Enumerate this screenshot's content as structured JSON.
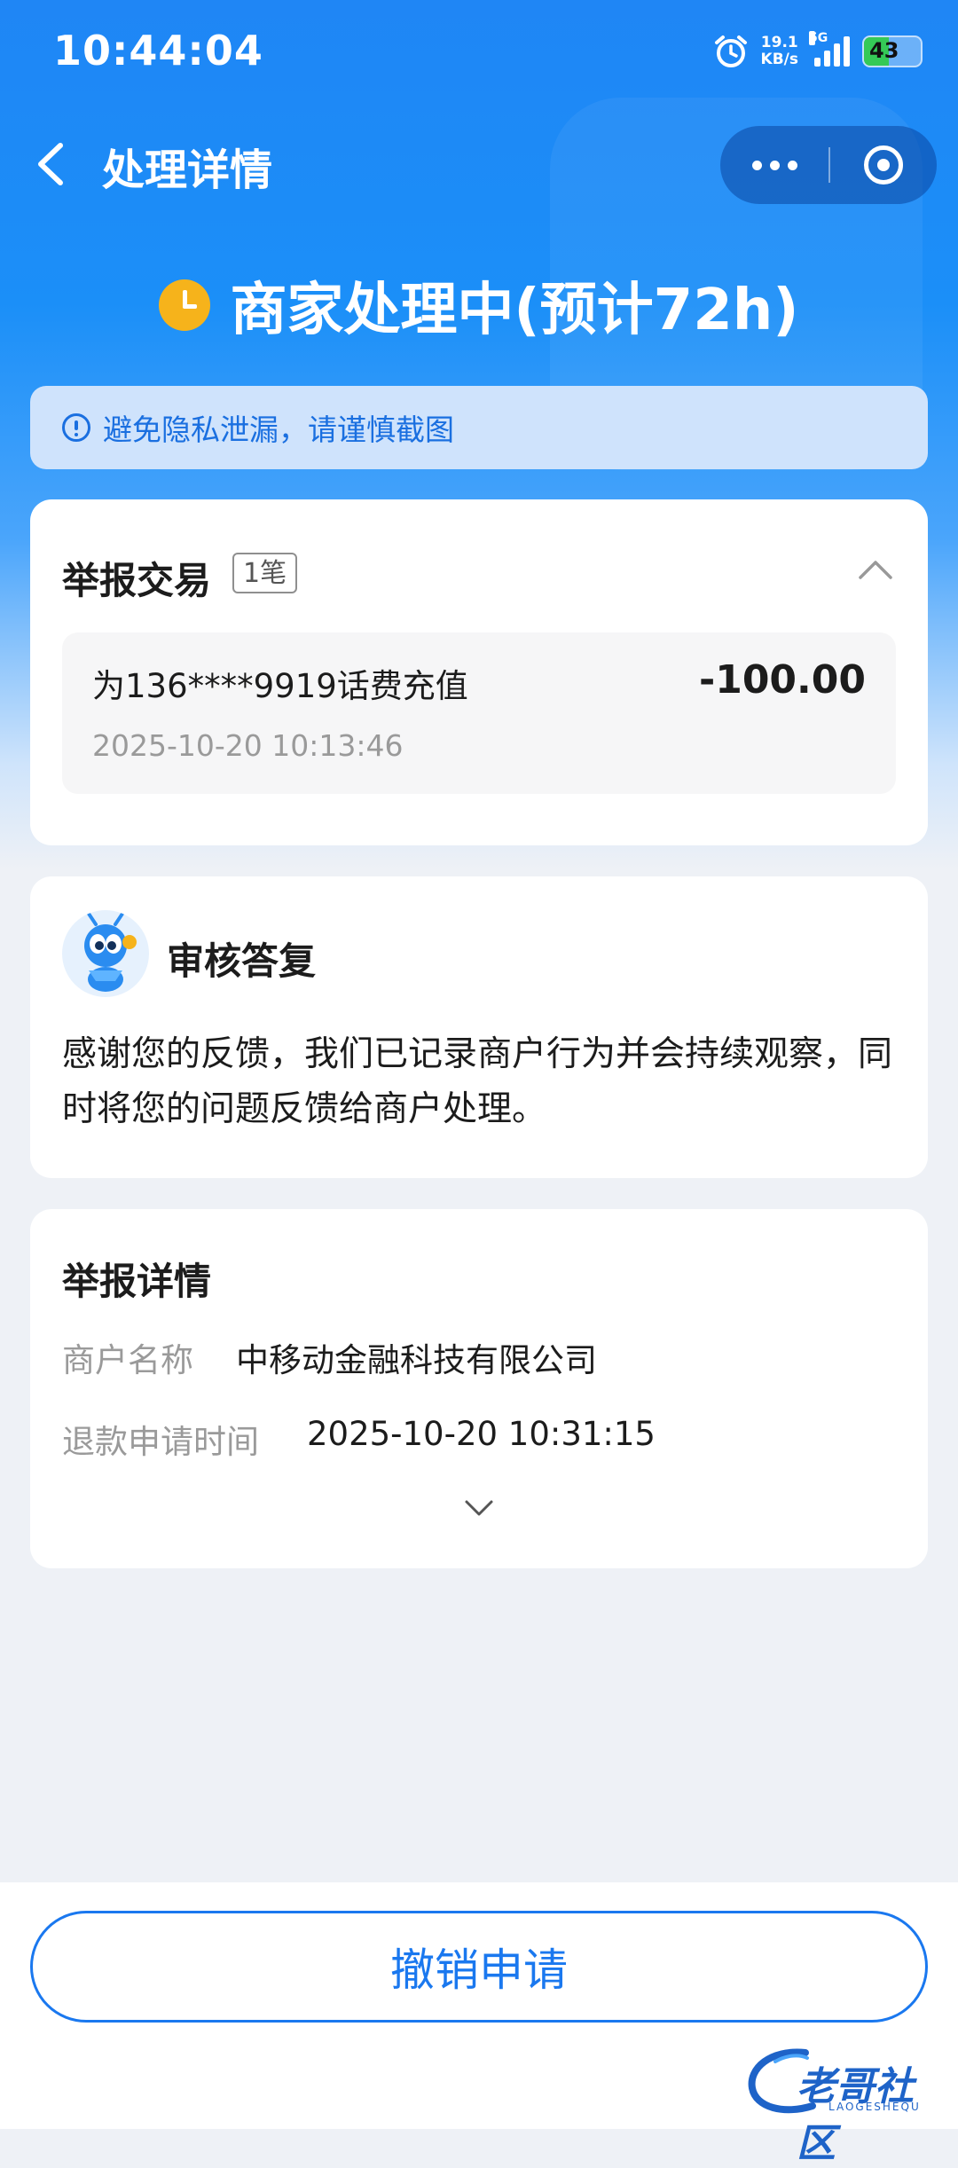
{
  "status_bar": {
    "time": "10:44:04",
    "net_speed_value": "19.1",
    "net_speed_unit": "KB/s",
    "network_type": "5G",
    "battery_level": "43",
    "battery_fraction": 0.43
  },
  "nav": {
    "title": "处理详情"
  },
  "status": {
    "text": "商家处理中(预计72h)",
    "icon": "clock-icon",
    "icon_color": "#f6b31b"
  },
  "notice": {
    "text": "避免隐私泄漏，请谨慎截图"
  },
  "report_transaction": {
    "title": "举报交易",
    "count_badge": "1笔",
    "item": {
      "name": "为136****9919话费充值",
      "amount": "-100.00",
      "time": "2025-10-20 10:13:46"
    }
  },
  "review_reply": {
    "title": "审核答复",
    "text": "感谢您的反馈，我们已记录商户行为并会持续观察，同时将您的问题反馈给商户处理。"
  },
  "report_details": {
    "title": "举报详情",
    "merchant_label": "商户名称",
    "merchant_value": "中移动金融科技有限公司",
    "refund_time_label": "退款申请时间",
    "refund_time_value": "2025-10-20 10:31:15"
  },
  "bottom": {
    "cancel_label": "撤销申请"
  },
  "watermark": {
    "text": "老哥社区",
    "subtext": "LAOGESHEQU"
  },
  "colors": {
    "primary_blue": "#1a78ef",
    "header_blue": "#1f86f5",
    "notice_bg": "#cfe3fc",
    "pending_orange": "#f6b31b"
  }
}
